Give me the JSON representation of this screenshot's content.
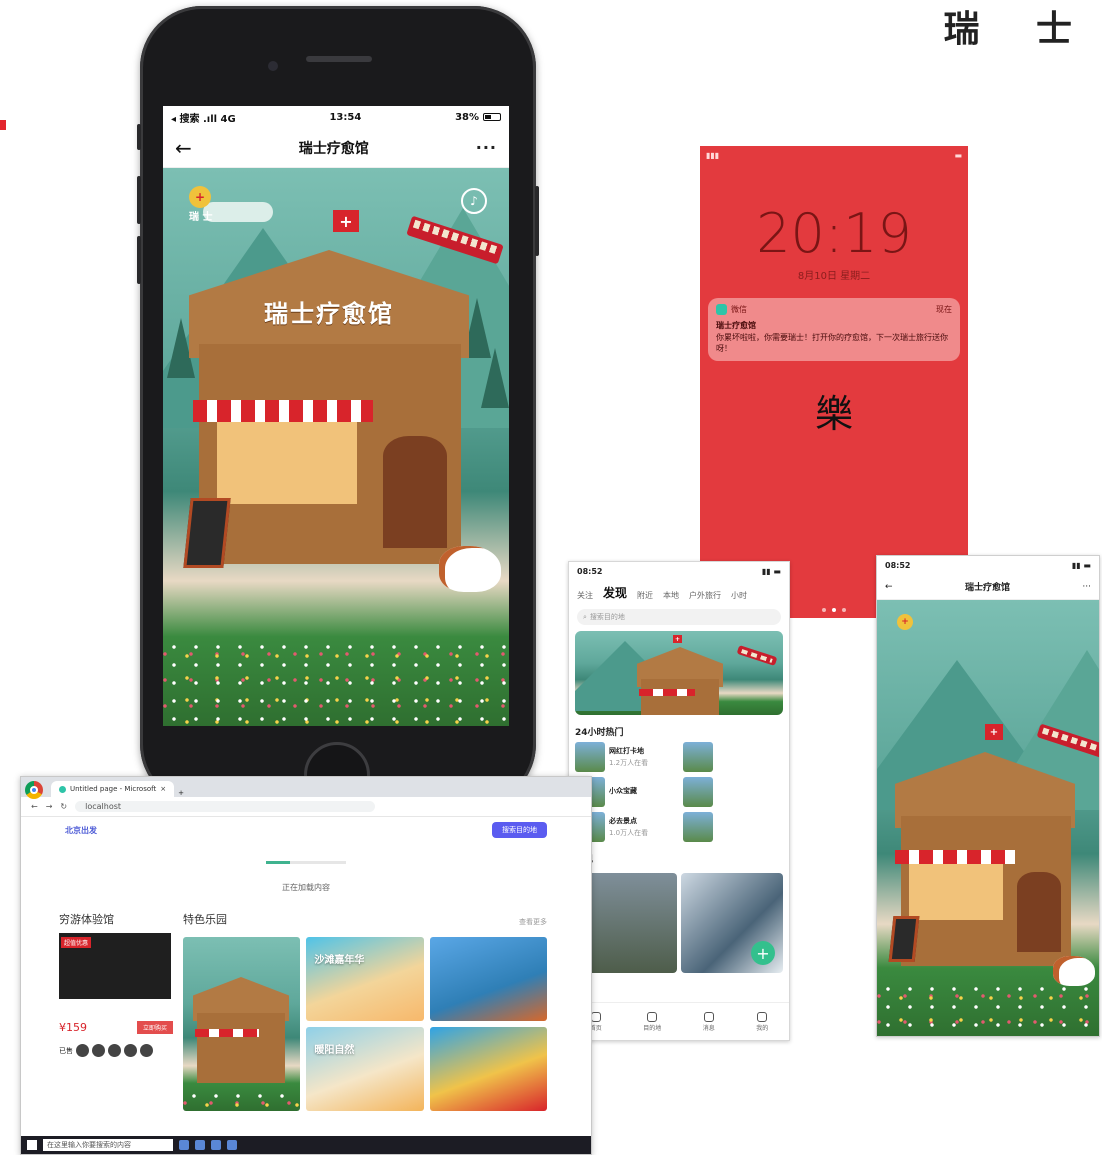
{
  "corner_title": "瑞 士",
  "main_phone": {
    "status": {
      "carrier": "◂ 搜索 .ıll 4G",
      "time": "13:54",
      "battery": "38%"
    },
    "nav": {
      "back_glyph": "←",
      "title": "瑞士疗愈馆",
      "more_glyph": "···"
    },
    "illustration": {
      "badge_text": "瑞 士",
      "sign": "瑞士疗愈馆",
      "music_glyph": "♪"
    }
  },
  "lock_screen": {
    "time": "20:19",
    "date": "8月10日 星期二",
    "notification": {
      "app": "微信",
      "when": "现在",
      "title": "瑞士疗愈馆",
      "body": "你累坏啦啦，你需要瑞士！打开你的疗愈馆，下一次瑞士旅行送你呀！"
    },
    "glyph": "樂"
  },
  "discover_phone": {
    "status_time": "08:52",
    "tabs": [
      "关注",
      "发现",
      "附近",
      "本地",
      "户外旅行",
      "小时"
    ],
    "active_tab": "发现",
    "search_placeholder": "搜索目的地",
    "section_hot": "24小时热门",
    "hot_items": [
      {
        "name": "网红打卡地",
        "heat": "1.2万人在看"
      },
      {
        "name": "小众宝藏",
        "heat": ""
      },
      {
        "name": "必去景点",
        "heat": "1.0万人在看"
      },
      {
        "name": "",
        "heat": ""
      },
      {
        "name": "",
        "heat": ""
      },
      {
        "name": "",
        "heat": ""
      }
    ],
    "section_discover": "发现",
    "fab_glyph": "+",
    "bottom_nav": [
      "首页",
      "目的地",
      "消息",
      "我的"
    ]
  },
  "right_phone": {
    "status_time": "08:52",
    "nav": {
      "back_glyph": "←",
      "title": "瑞士疗愈馆",
      "more_glyph": "···"
    }
  },
  "browser": {
    "tab_title": "Untitled page - Microsoft",
    "url": "localhost",
    "city": "北京出发",
    "search_button": "搜索目的地",
    "progress": 0.3,
    "hint": "正在加载内容",
    "col_left_title": "穷游体验馆",
    "product_tag": "超值优惠",
    "price": "¥159",
    "buy_label": "立即购买",
    "avatar_label": "已售",
    "col_right_title": "特色乐园",
    "more_link": "查看更多",
    "cards": [
      {
        "title": ""
      },
      {
        "title": "沙滩嘉年华"
      },
      {
        "title": ""
      },
      {
        "title": "暖阳自然"
      },
      {
        "title": ""
      }
    ],
    "taskbar_search": "在这里输入你要搜索的内容"
  }
}
